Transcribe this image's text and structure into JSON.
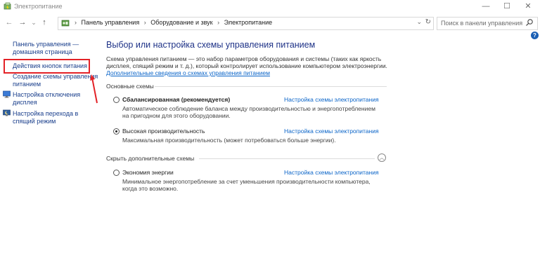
{
  "window": {
    "title": "Электропитание",
    "controls": {
      "minimize": "—",
      "maximize": "☐",
      "close": "✕"
    }
  },
  "nav": {
    "back": "←",
    "forward": "→",
    "recent": "⌄",
    "up": "↑",
    "breadcrumbs": [
      "Панель управления",
      "Оборудование и звук",
      "Электропитание"
    ],
    "search_placeholder": "Поиск в панели управления"
  },
  "help": {
    "label": "?"
  },
  "left_pane": {
    "home": {
      "line1": "Панель управления —",
      "line2": "домашняя страница"
    },
    "power_buttons": "Действия кнопок питания",
    "create_plan": {
      "line1": "Создание схемы управления",
      "line2": "питанием"
    },
    "display_off": {
      "line1": "Настройка отключения",
      "line2": "дисплея"
    },
    "sleep": {
      "line1": "Настройка перехода в",
      "line2": "спящий режим"
    }
  },
  "main": {
    "title": "Выбор или настройка схемы управления питанием",
    "description": {
      "line1": "Схема управления питанием — это набор параметров оборудования и системы (таких как яркость",
      "line2": "дисплея, спящий режим и т. д.), который контролирует использование компьютером электроэнергии."
    },
    "more_link": "Дополнительные сведения о схемах управления питанием",
    "basic_group": "Основные схемы",
    "hidden_group": "Скрыть дополнительные схемы",
    "plans": [
      {
        "name": "Сбалансированная (рекомендуется)",
        "desc_line1": "Автоматическое соблюдение баланса между производительностью и энергопотреблением",
        "desc_line2": "на пригодном для этого оборудовании.",
        "link": "Настройка схемы электропитания",
        "selected": false
      },
      {
        "name": "Высокая производительность",
        "desc_line1": "Максимальная производительность (может потребоваться больше энергии).",
        "desc_line2": "",
        "link": "Настройка схемы электропитания",
        "selected": true
      },
      {
        "name": "Экономия энергии",
        "desc_line1": "Минимальное энергопотребление за счет уменьшения производительности компьютера,",
        "desc_line2": "когда это возможно.",
        "link": "Настройка схемы электропитания",
        "selected": false
      }
    ]
  },
  "icons": {
    "window_icon": "power-options-icon",
    "address_icon": "control-panel-icon",
    "search_icon": "search-icon",
    "display_icon": "monitor-icon",
    "sleep_icon": "moon-icon"
  },
  "annotation": {
    "highlight_color": "#e32227",
    "arrow_color": "#e32227"
  },
  "colors": {
    "link": "#0a64c8",
    "title": "#1e3287",
    "nav_link": "#1a3f8c"
  }
}
